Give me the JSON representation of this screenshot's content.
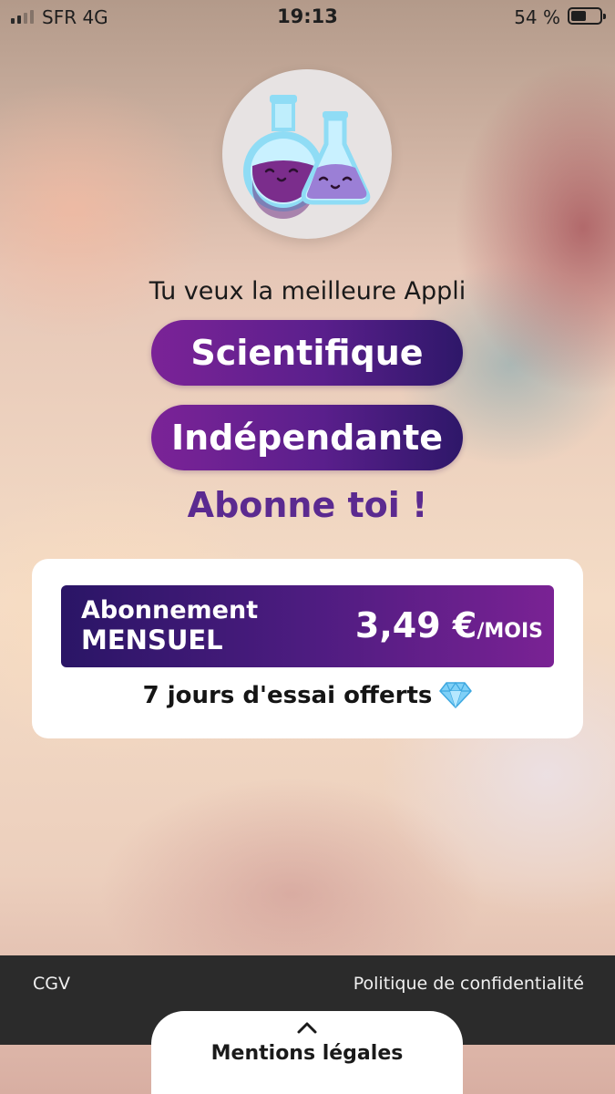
{
  "status_bar": {
    "carrier": "SFR   4G",
    "time": "19:13",
    "battery_percent": "54 %",
    "battery_level": 0.54,
    "signal_bars": 2
  },
  "logo": {
    "icon": "potion-flasks-icon",
    "colors": {
      "liquid_dark": "#7b2d8c",
      "liquid_light": "#9b7fd6",
      "glass": "#8fdcf5"
    }
  },
  "headline": {
    "intro": "Tu veux la meilleure Appli",
    "pill_1": "Scientifique",
    "pill_2": "Indépendante",
    "cta": "Abonne toi !"
  },
  "offer": {
    "plan_line1": "Abonnement",
    "plan_line2": "MENSUEL",
    "price": "3,49 €",
    "period": "/MOIS",
    "trial": "7 jours d'essai offerts",
    "trial_icon": "diamond-icon"
  },
  "footer": {
    "cgv": "CGV",
    "privacy": "Politique de confidentialité",
    "legal": "Mentions légales",
    "legal_icon": "chevron-up-icon"
  },
  "colors": {
    "accent_purple": "#5b2a90",
    "gradient_start": "#7b2397",
    "gradient_end": "#2e1769",
    "footer_bg": "#2b2b2b"
  }
}
